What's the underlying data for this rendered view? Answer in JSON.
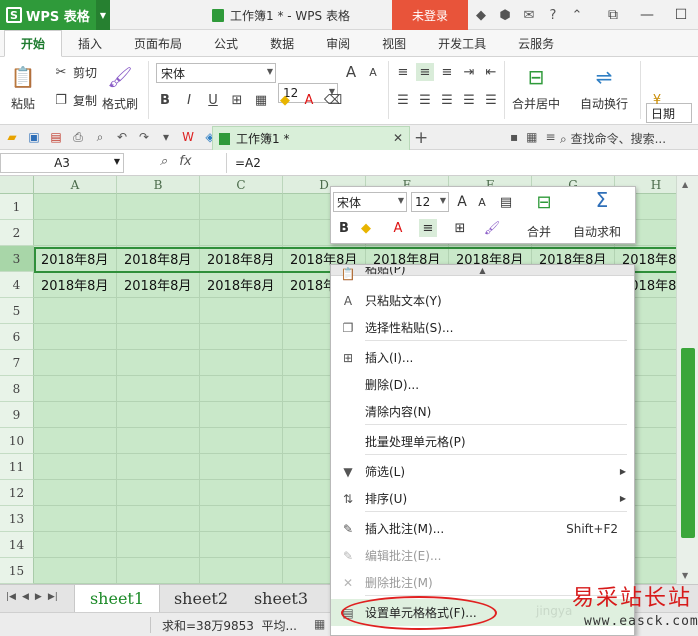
{
  "titlebar": {
    "app_logo": "S",
    "app_name": "WPS 表格",
    "document_title": "工作簿1 * - WPS 表格",
    "login_label": "未登录",
    "help_icon_text": "?",
    "colors": {
      "app": "#2f9a3a",
      "login": "#e8543a"
    }
  },
  "ribbon_tabs": [
    "开始",
    "插入",
    "页面布局",
    "公式",
    "数据",
    "审阅",
    "视图",
    "开发工具",
    "云服务"
  ],
  "ribbon": {
    "paste_label": "粘贴",
    "cut_label": "剪切",
    "copy_label": "复制",
    "format_painter_label": "格式刷",
    "font_name": "宋体",
    "font_size": "12",
    "bold": "B",
    "italic": "I",
    "underline": "U",
    "merge_label": "合并居中",
    "wrap_label": "自动换行",
    "number_format": "日期"
  },
  "quickbar": {
    "doc_tab_label": "工作簿1 *",
    "plus": "+",
    "search_label": "查找命令、搜索..."
  },
  "formulabar": {
    "cell_ref": "A3",
    "fx_label": "fx",
    "formula": "=A2"
  },
  "grid": {
    "columns": [
      "A",
      "B",
      "C",
      "D",
      "E",
      "F",
      "G",
      "H"
    ],
    "rows": [
      "1",
      "2",
      "3",
      "4",
      "5",
      "6",
      "7",
      "8",
      "9",
      "10",
      "11",
      "12",
      "13",
      "14",
      "15"
    ],
    "cell_value": "2018年8月",
    "selected_row": "3",
    "theme_color": "#c9e8c9"
  },
  "sheets": [
    "sheet1",
    "sheet2",
    "sheet3"
  ],
  "statusbar": {
    "sum_text": "求和=38万9853",
    "avg_text": "平均..."
  },
  "minibar": {
    "font_name": "宋体",
    "font_size": "12",
    "bold": "B",
    "merge_label": "合并",
    "autosum_label": "自动求和"
  },
  "context_menu": {
    "partial_top": "粘贴(P)",
    "items": [
      {
        "label": "只粘贴文本(Y)",
        "icon": "paste-text-icon"
      },
      {
        "label": "选择性粘贴(S)...",
        "icon": "paste-special-icon"
      },
      {
        "label": "插入(I)...",
        "icon": "insert-icon"
      },
      {
        "label": "删除(D)...",
        "icon": ""
      },
      {
        "label": "清除内容(N)",
        "icon": ""
      },
      {
        "label": "批量处理单元格(P)",
        "icon": ""
      },
      {
        "label": "筛选(L)",
        "icon": "filter-icon"
      },
      {
        "label": "排序(U)",
        "icon": "sort-icon"
      },
      {
        "label": "插入批注(M)...",
        "icon": "insert-comment-icon",
        "shortcut": "Shift+F2"
      },
      {
        "label": "编辑批注(E)...",
        "icon": "edit-comment-icon"
      },
      {
        "label": "删除批注(M)",
        "icon": "delete-comment-icon"
      },
      {
        "label": "设置单元格格式(F)...",
        "icon": "format-cells-icon"
      }
    ]
  },
  "watermark": {
    "title": "易采站长站",
    "url": "www.easck.com",
    "faint": "jingya"
  }
}
